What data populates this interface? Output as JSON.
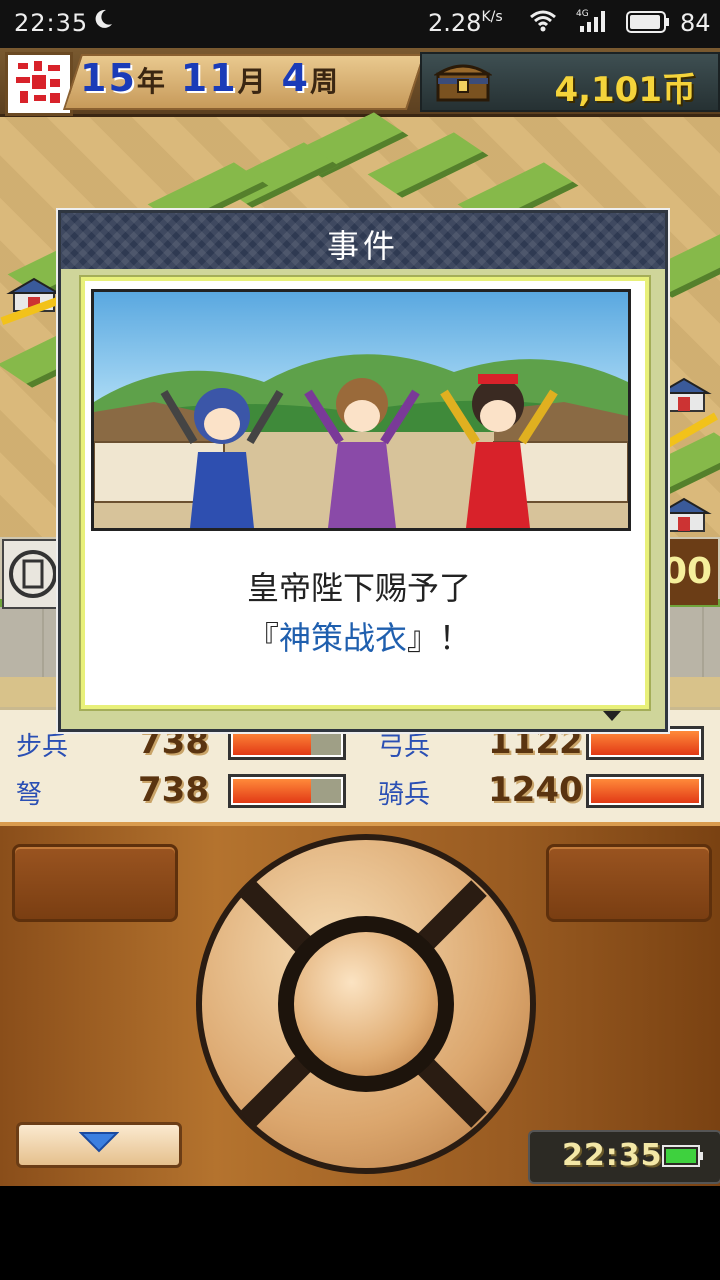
{
  "status_bar": {
    "time": "22:35",
    "net_speed": "2.28",
    "net_speed_unit": "K/s",
    "network_type": "4G",
    "battery": "84",
    "icons": [
      "moon-icon",
      "wifi-icon",
      "signal-icon",
      "battery-icon"
    ]
  },
  "header": {
    "year_num": "15",
    "year_unit": "年",
    "month_num": "11",
    "month_unit": "月",
    "week_num": "4",
    "week_unit": "周",
    "money": "4,101币"
  },
  "battle": {
    "score_partial": "00"
  },
  "troops": [
    {
      "name": "步兵",
      "count": "738",
      "level": 0.73
    },
    {
      "name": "弓兵",
      "count": "1122",
      "level": 1.0
    },
    {
      "name": "弩",
      "count": "738",
      "level": 0.73
    },
    {
      "name": "骑兵",
      "count": "1240",
      "level": 1.0
    }
  ],
  "dialog": {
    "title": "事件",
    "line1": "皇帝陛下赐予了",
    "quote_open": "『",
    "item": "神策战衣",
    "quote_close": "』！"
  },
  "controller": {
    "clock": "22:35"
  },
  "colors": {
    "accent_blue": "#1f3da8",
    "money_gold": "#f5d43b",
    "bar_red": "#e23a16",
    "dialog_header": "#2f3a52"
  }
}
